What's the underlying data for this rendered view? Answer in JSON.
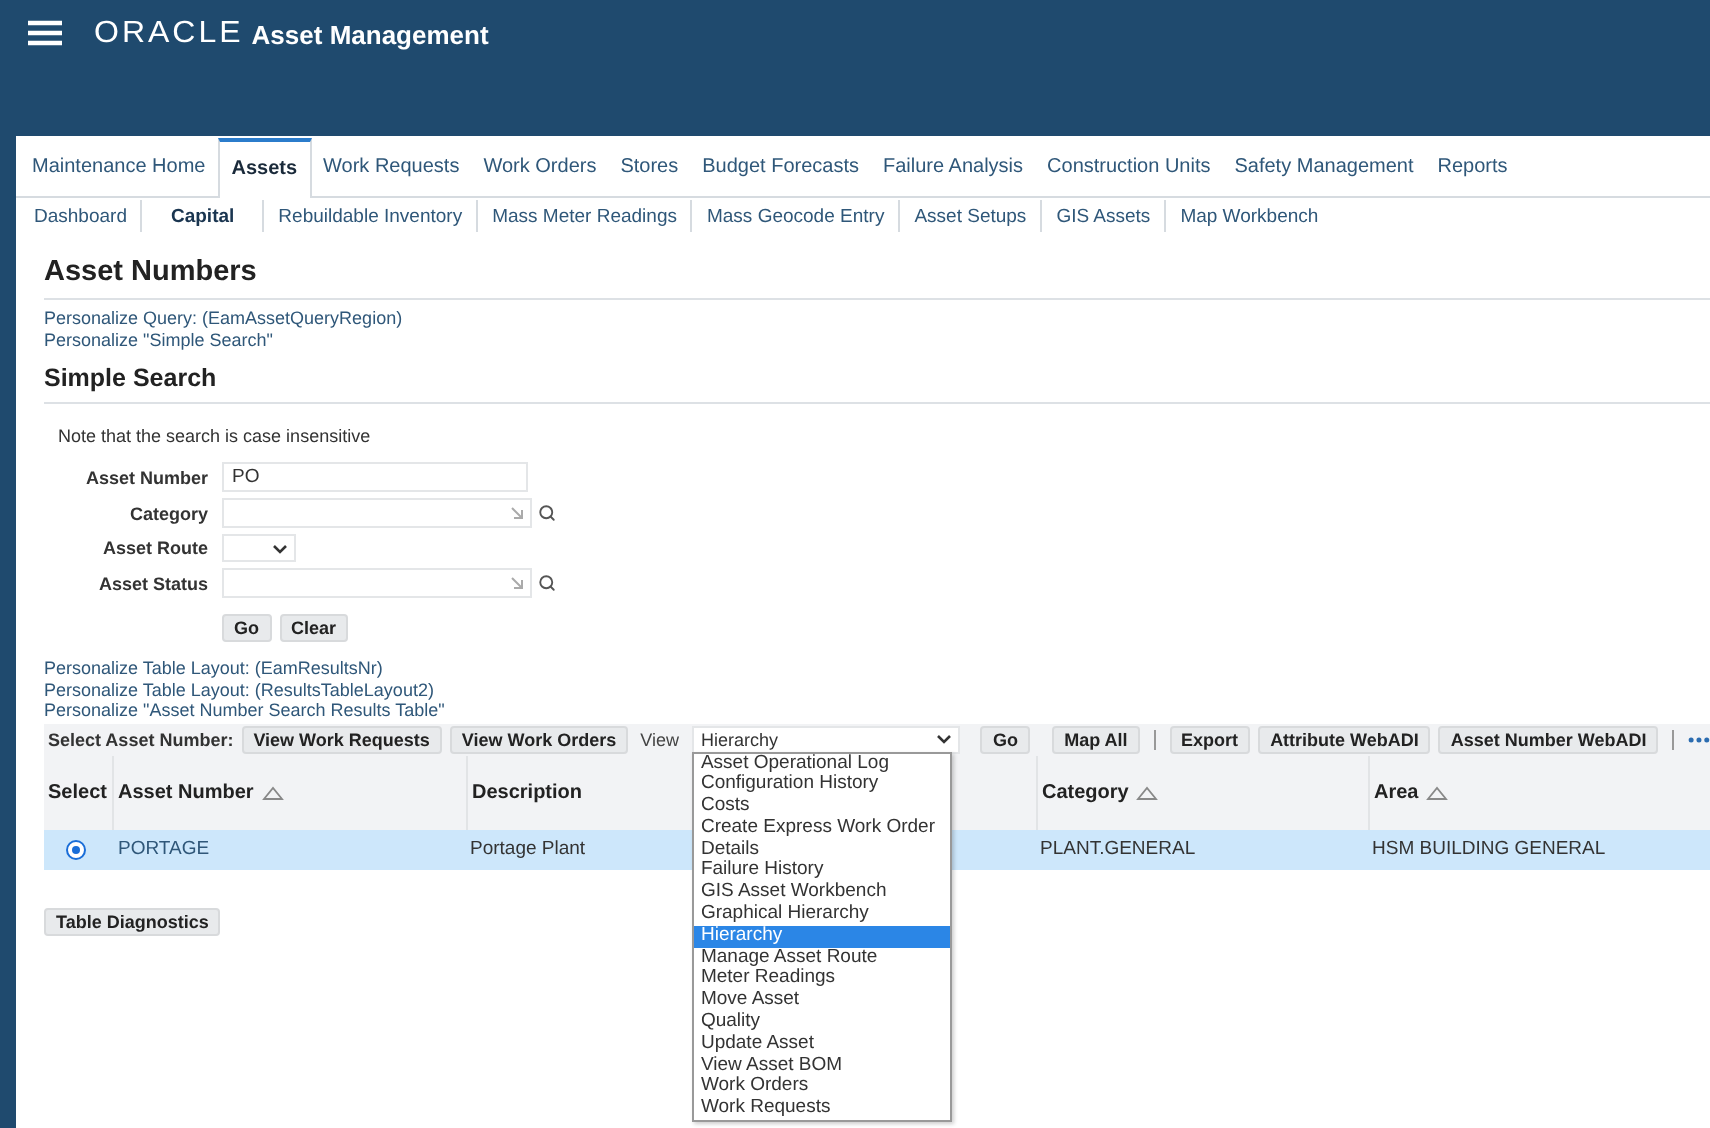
{
  "header": {
    "logo": "ORACLE",
    "app_title": "Asset Management"
  },
  "tabs": [
    {
      "label": "Maintenance Home",
      "selected": false
    },
    {
      "label": "Assets",
      "selected": true
    },
    {
      "label": "Work Requests",
      "selected": false
    },
    {
      "label": "Work Orders",
      "selected": false
    },
    {
      "label": "Stores",
      "selected": false
    },
    {
      "label": "Budget Forecasts",
      "selected": false
    },
    {
      "label": "Failure Analysis",
      "selected": false
    },
    {
      "label": "Construction Units",
      "selected": false
    },
    {
      "label": "Safety Management",
      "selected": false
    },
    {
      "label": "Reports",
      "selected": false
    }
  ],
  "subtabs": [
    {
      "label": "Dashboard",
      "selected": false
    },
    {
      "label": "Capital",
      "selected": true
    },
    {
      "label": "Rebuildable Inventory",
      "selected": false
    },
    {
      "label": "Mass Meter Readings",
      "selected": false
    },
    {
      "label": "Mass Geocode Entry",
      "selected": false
    },
    {
      "label": "Asset Setups",
      "selected": false
    },
    {
      "label": "GIS Assets",
      "selected": false
    },
    {
      "label": "Map Workbench",
      "selected": false
    }
  ],
  "page_title": "Asset Numbers",
  "query_links": [
    "Personalize Query: (EamAssetQueryRegion)",
    "Personalize \"Simple Search\""
  ],
  "section_title": "Simple Search",
  "note": "Note that the search is case insensitive",
  "fields": [
    {
      "label": "Asset Number",
      "kind": "text",
      "value": "PO"
    },
    {
      "label": "Category",
      "kind": "lov"
    },
    {
      "label": "Asset Route",
      "kind": "select"
    },
    {
      "label": "Asset Status",
      "kind": "lov"
    }
  ],
  "search_buttons": [
    "Go",
    "Clear"
  ],
  "table_links": [
    "Personalize Table Layout: (EamResultsNr)",
    "Personalize Table Layout: (ResultsTableLayout2)",
    "Personalize \"Asset Number Search Results Table\""
  ],
  "toolbar": {
    "label": "Select Asset Number:",
    "buttons": [
      "View Work Requests",
      "View Work Orders"
    ],
    "view_label": "View",
    "view_value": "Hierarchy",
    "go": "Go",
    "items_right": [
      {
        "kind": "button",
        "label": "Map All"
      },
      {
        "kind": "divider"
      },
      {
        "kind": "button",
        "label": "Export"
      },
      {
        "kind": "button",
        "label": "Attribute WebADI"
      },
      {
        "kind": "button",
        "label": "Asset Number WebADI"
      },
      {
        "kind": "divider"
      }
    ]
  },
  "view_options": [
    {
      "label": "Asset Operational Log",
      "selected": false
    },
    {
      "label": "Configuration History",
      "selected": false
    },
    {
      "label": "Costs",
      "selected": false
    },
    {
      "label": "Create Express Work Order",
      "selected": false
    },
    {
      "label": "Details",
      "selected": false
    },
    {
      "label": "Failure History",
      "selected": false
    },
    {
      "label": "GIS Asset Workbench",
      "selected": false
    },
    {
      "label": "Graphical Hierarchy",
      "selected": false
    },
    {
      "label": "Hierarchy",
      "selected": true
    },
    {
      "label": "Manage Asset Route",
      "selected": false
    },
    {
      "label": "Meter Readings",
      "selected": false
    },
    {
      "label": "Move Asset",
      "selected": false
    },
    {
      "label": "Quality",
      "selected": false
    },
    {
      "label": "Update Asset",
      "selected": false
    },
    {
      "label": "View Asset BOM",
      "selected": false
    },
    {
      "label": "Work Orders",
      "selected": false
    },
    {
      "label": "Work Requests",
      "selected": false
    }
  ],
  "table": {
    "columns": [
      {
        "label": "Select",
        "kind": "plain"
      },
      {
        "label": "Asset Number",
        "kind": "sortable"
      },
      {
        "label": "Description",
        "kind": "plain"
      },
      {
        "label": "Category",
        "kind": "sortable"
      },
      {
        "label": "Area",
        "kind": "sortable"
      }
    ],
    "rows": [
      {
        "selected": true,
        "asset_number": "PORTAGE",
        "description": "Portage Plant",
        "category": "PLANT.GENERAL",
        "area": "HSM BUILDING GENERAL"
      }
    ]
  },
  "diagnostics_button": "Table Diagnostics"
}
